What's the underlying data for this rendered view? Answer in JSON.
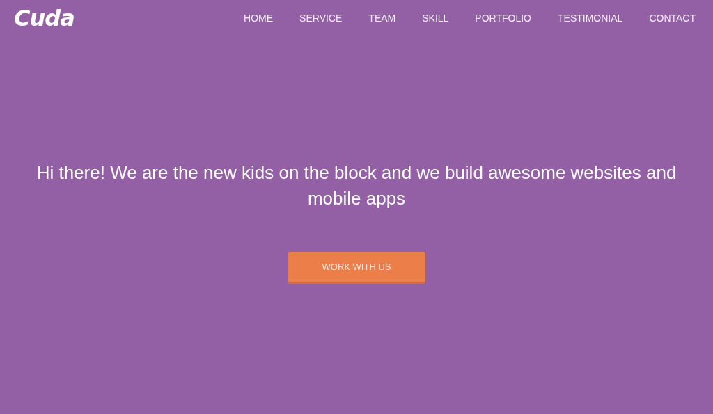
{
  "header": {
    "logo": "Cuda",
    "nav": [
      {
        "label": "HOME"
      },
      {
        "label": "SERVICE"
      },
      {
        "label": "TEAM"
      },
      {
        "label": "SKILL"
      },
      {
        "label": "PORTFOLIO"
      },
      {
        "label": "TESTIMONIAL"
      },
      {
        "label": "CONTACT"
      }
    ]
  },
  "hero": {
    "heading": "Hi there! We are the new kids on the block and we build awesome websites and mobile apps",
    "button": "WORK WITH US"
  }
}
